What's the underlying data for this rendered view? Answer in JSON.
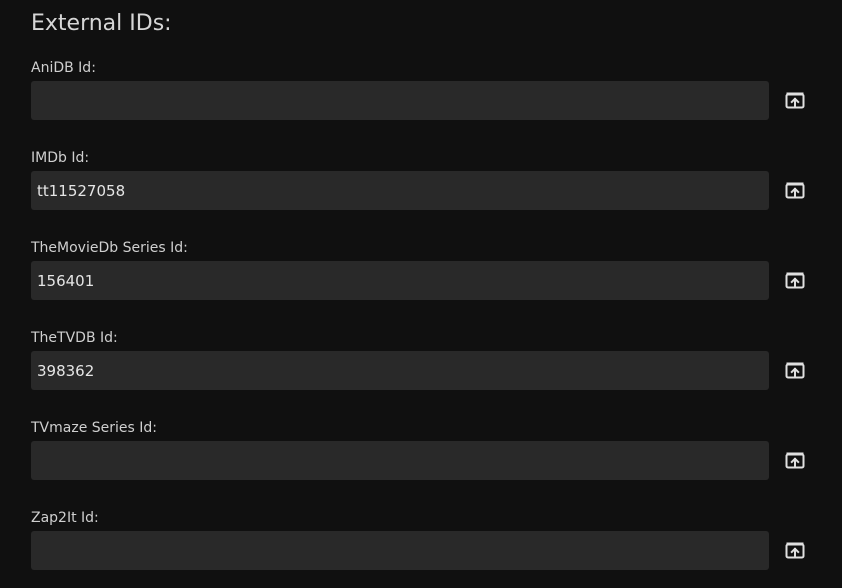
{
  "section": {
    "title": "External IDs:"
  },
  "fields": [
    {
      "key": "anidb",
      "label": "AniDB Id:",
      "value": "",
      "button_icon": "open-external-icon"
    },
    {
      "key": "imdb",
      "label": "IMDb Id:",
      "value": "tt11527058",
      "button_icon": "open-external-icon"
    },
    {
      "key": "tmdb",
      "label": "TheMovieDb Series Id:",
      "value": "156401",
      "button_icon": "open-external-icon"
    },
    {
      "key": "tvdb",
      "label": "TheTVDB Id:",
      "value": "398362",
      "button_icon": "open-external-icon"
    },
    {
      "key": "tvmaze",
      "label": "TVmaze Series Id:",
      "value": "",
      "button_icon": "open-external-icon"
    },
    {
      "key": "zap2it",
      "label": "Zap2It Id:",
      "value": "",
      "button_icon": "open-external-icon"
    }
  ],
  "colors": {
    "background": "#101010",
    "input_background": "#292929",
    "text": "#dcdcdc",
    "icon": "#e0e0e0"
  }
}
